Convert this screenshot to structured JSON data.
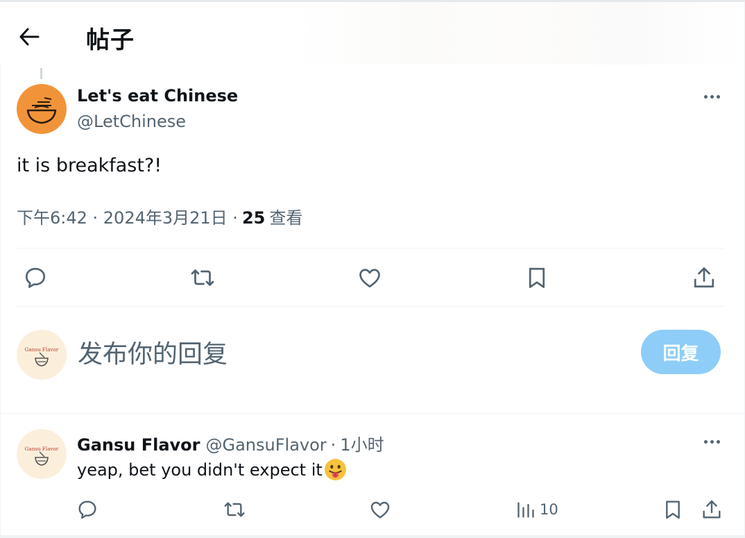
{
  "header": {
    "title": "帖子",
    "back_icon": "arrow-left-icon"
  },
  "post": {
    "author_name": "Let's eat Chinese",
    "author_handle": "@LetChinese",
    "avatar_color": "#f19439",
    "text": "it is breakfast?!",
    "time": "下午6:42 · 2024年3月21日 ·",
    "views_count": "25",
    "views_label": "查看"
  },
  "actions": {
    "reply_icon": "reply-icon",
    "retweet_icon": "retweet-icon",
    "like_icon": "like-icon",
    "bookmark_icon": "bookmark-icon",
    "share_icon": "share-icon"
  },
  "composer": {
    "placeholder": "发布你的回复",
    "button_label": "回复",
    "button_color": "#8ecdf7",
    "avatar_text": "Gansu Flavor"
  },
  "reply": {
    "author_name": "Gansu Flavor",
    "author_handle": "@GansuFlavor",
    "separator": "·",
    "time": "1小时",
    "text": "yeap, bet you didn't expect it",
    "emoji_icon": "tongue-face-emoji-icon",
    "avatar_text": "Gansu Flavor",
    "views_count": "10"
  },
  "colors": {
    "text_primary": "#0f1419",
    "text_secondary": "#536471",
    "divider": "#eff3f4"
  }
}
